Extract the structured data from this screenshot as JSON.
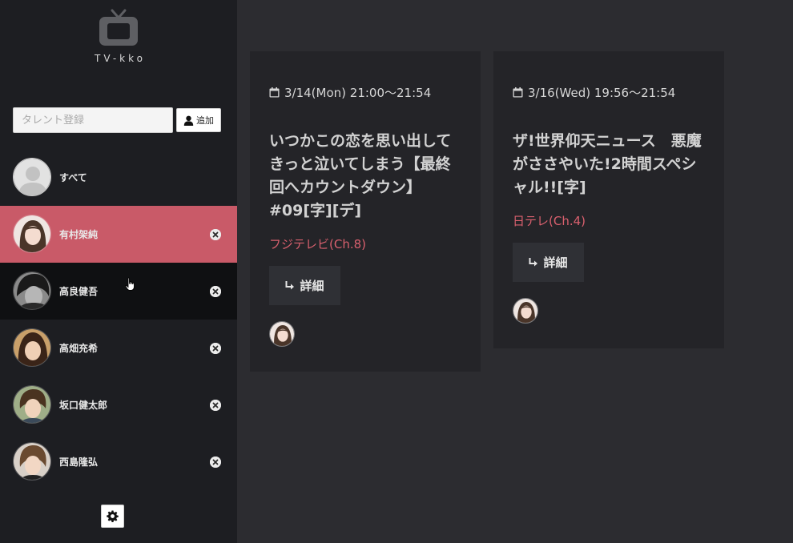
{
  "app": {
    "title": "TV-kko"
  },
  "talent_form": {
    "placeholder": "タレント登録",
    "add_label": "追加"
  },
  "sidebar": {
    "items": [
      {
        "name": "すべて",
        "removable": false
      },
      {
        "name": "有村架純",
        "removable": true,
        "state": "active"
      },
      {
        "name": "高良健吾",
        "removable": true,
        "state": "hover"
      },
      {
        "name": "高畑充希",
        "removable": true
      },
      {
        "name": "坂口健太郎",
        "removable": true
      },
      {
        "name": "西島隆弘",
        "removable": true
      }
    ]
  },
  "programs": [
    {
      "datetime": "3/14(Mon) 21:00〜21:54",
      "title": "いつかこの恋を思い出してきっと泣いてしまう【最終回へカウントダウン】#09[字][デ]",
      "channel": "フジテレビ(Ch.8)",
      "detail_label": "詳細"
    },
    {
      "datetime": "3/16(Wed) 19:56〜21:54",
      "title": "ザ!世界仰天ニュース　悪魔がささやいた!2時間スペシャル!![字]",
      "channel": "日テレ(Ch.4)",
      "detail_label": "詳細"
    }
  ],
  "colors": {
    "accent": "#c95a68",
    "channel": "#d9606e",
    "sidebar_bg": "#1d1e22",
    "main_bg": "#2c2c30",
    "card_bg": "#242428"
  },
  "icons": {
    "logo": "tv-icon",
    "add": "user-icon",
    "remove": "close-circle-icon",
    "settings": "gear-icon",
    "date": "calendar-icon",
    "detail": "return-arrow-icon"
  }
}
